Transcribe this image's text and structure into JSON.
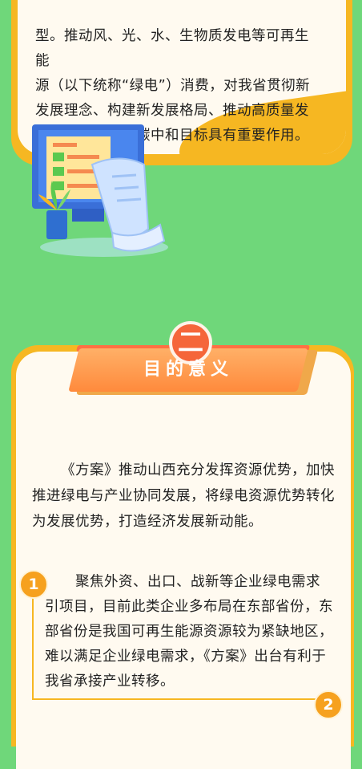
{
  "top_card": {
    "lines": [
      "型。推动风、光、水、生物质发电等可再生能",
      "源（以下统称“绿电”）消费，对我省贯彻新",
      "发展理念、构建新发展格局、推动高质量发",
      "展、实现碳达峰碳中和目标具有重要作用。"
    ]
  },
  "section2": {
    "number": "二",
    "title": "目的意义",
    "paragraph": "《方案》推动山西充分发挥资源优势，加快推进绿电与产业协同发展，将绿电资源优势转化为发展优势，打造经济发展新动能。",
    "point1": {
      "badge": "1",
      "text": "聚焦外资、出口、战新等企业绿电需求引项目，目前此类企业多布局在东部省份，东部省份是我国可再生能源资源较为紧缺地区，难以满足企业绿电需求，《方案》出台有利于我省承接产业转移。"
    },
    "point2": {
      "badge": "2"
    }
  },
  "colors": {
    "background": "#6fd77a",
    "card_border": "#f6b722",
    "banner": "#ff8a3c",
    "number_circle": "#f5663a",
    "badge": "#f6a11f"
  }
}
